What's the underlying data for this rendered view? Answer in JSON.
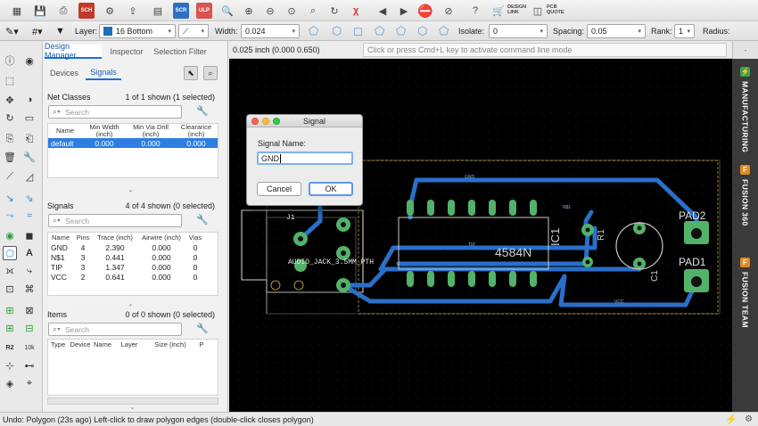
{
  "toolbar_top": {
    "scr_label": "SCR",
    "ulp_label": "ULP",
    "design_link_label": "DESIGN\nLINK",
    "pcb_quote_label": "PCB\nQUOTE"
  },
  "toolbar_params": {
    "layer_label": "Layer:",
    "layer_value": "16 Bottom",
    "layer_color": "#1f6fb8",
    "width_label": "Width:",
    "width_value": "0.024",
    "isolate_label": "Isolate:",
    "isolate_value": "0",
    "spacing_label": "Spacing:",
    "spacing_value": "0.05",
    "rank_label": "Rank:",
    "rank_value": "1",
    "radius_label": "Radius:"
  },
  "panel": {
    "tabs": [
      "Design Manager",
      "Inspector",
      "Selection Filter"
    ],
    "subtabs": [
      "Devices",
      "Signals"
    ],
    "net_classes": {
      "title": "Net Classes",
      "count": "1 of 1 shown (1 selected)",
      "search_placeholder": "Search",
      "columns": [
        "Name",
        "Min Width\n(inch)",
        "Min Via Drill\n(inch)",
        "Clearance\n(inch)"
      ],
      "rows": [
        [
          "default",
          "0.000",
          "0.000",
          "0.000"
        ]
      ]
    },
    "signals": {
      "title": "Signals",
      "count": "4 of 4 shown (0 selected)",
      "search_placeholder": "Search",
      "columns": [
        "Name",
        "Pins",
        "Trace (inch)",
        "Airwire (inch)",
        "Vias"
      ],
      "rows": [
        [
          "GND",
          "4",
          "2.390",
          "0.000",
          "0"
        ],
        [
          "N$1",
          "3",
          "0.441",
          "0.000",
          "0"
        ],
        [
          "TIP",
          "3",
          "1.347",
          "0.000",
          "0"
        ],
        [
          "VCC",
          "2",
          "0.641",
          "0.000",
          "0"
        ]
      ]
    },
    "items": {
      "title": "Items",
      "count": "0 of 0 shown (0 selected)",
      "search_placeholder": "Search",
      "columns": [
        "Type",
        "Device",
        "Name",
        "Layer",
        "Size (inch)",
        "P"
      ]
    }
  },
  "canvas": {
    "coordinate": "0.025 inch (0.000 0.650)",
    "command_placeholder": "Click or press Cmd+L key to activate command line mode",
    "labels": {
      "j1": "J1",
      "jack": "AUDIO_JACK_3.5MM_PTH",
      "ic": "IC1",
      "chip": "4584N",
      "r1": "R1",
      "c1": "C1",
      "pad1": "PAD1",
      "pad2": "PAD2",
      "gnd": "GND",
      "ns1": "N$1",
      "tip": "TIP",
      "vcc": "VCC"
    }
  },
  "dock": {
    "tabs": [
      "MANUFACTURING",
      "FUSION 360",
      "FUSION TEAM"
    ]
  },
  "dialog": {
    "title": "Signal",
    "field_label": "Signal Name:",
    "field_value": "GND",
    "cancel_label": "Cancel",
    "ok_label": "OK"
  },
  "statusbar": {
    "message": "Undo: Polygon (23s ago) Left-click to draw polygon edges (double-click closes polygon)"
  }
}
